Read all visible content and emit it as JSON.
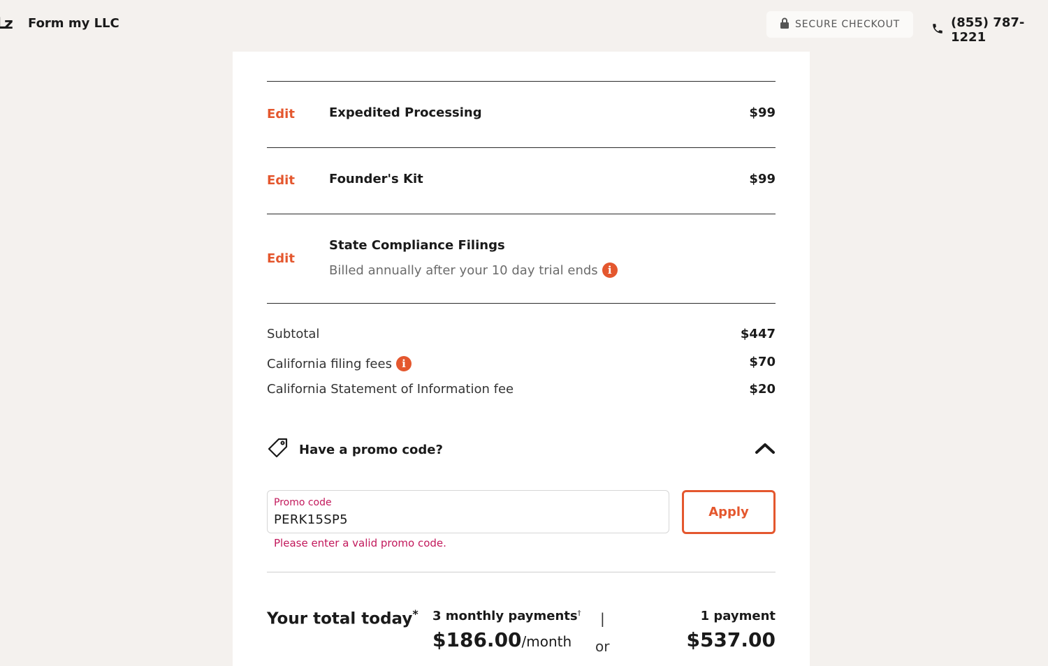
{
  "header": {
    "logo_mark": "Lz",
    "brand": "Form my LLC",
    "secure_label": "SECURE CHECKOUT",
    "phone": "(855) 787-1221"
  },
  "items": [
    {
      "edit": "Edit",
      "name": "Expedited Processing",
      "price": "$99"
    },
    {
      "edit": "Edit",
      "name": "Founder's Kit",
      "price": "$99"
    },
    {
      "edit": "Edit",
      "name": "State Compliance Filings",
      "note": "Billed annually after your 10 day trial ends",
      "info": "i"
    }
  ],
  "summary": {
    "subtotal_label": "Subtotal",
    "subtotal_value": "$447",
    "filing_label": "California filing fees",
    "filing_info": "i",
    "filing_value": "$70",
    "soi_label": "California Statement of Information fee",
    "soi_value": "$20"
  },
  "promo": {
    "heading": "Have a promo code?",
    "field_label": "Promo code",
    "field_value": "PERK15SP5",
    "error": "Please enter a valid promo code.",
    "apply_label": "Apply"
  },
  "total": {
    "label": "Your total today",
    "label_mark": "*",
    "monthly_head": "3 monthly payments",
    "monthly_mark": "†",
    "monthly_amount": "$186.00",
    "monthly_per": "/month",
    "divider": "|",
    "or": "or",
    "single_head": "1 payment",
    "single_amount": "$537.00"
  },
  "colors": {
    "accent": "#e4572e",
    "error": "#c2185b",
    "background": "#f4f1ee"
  }
}
